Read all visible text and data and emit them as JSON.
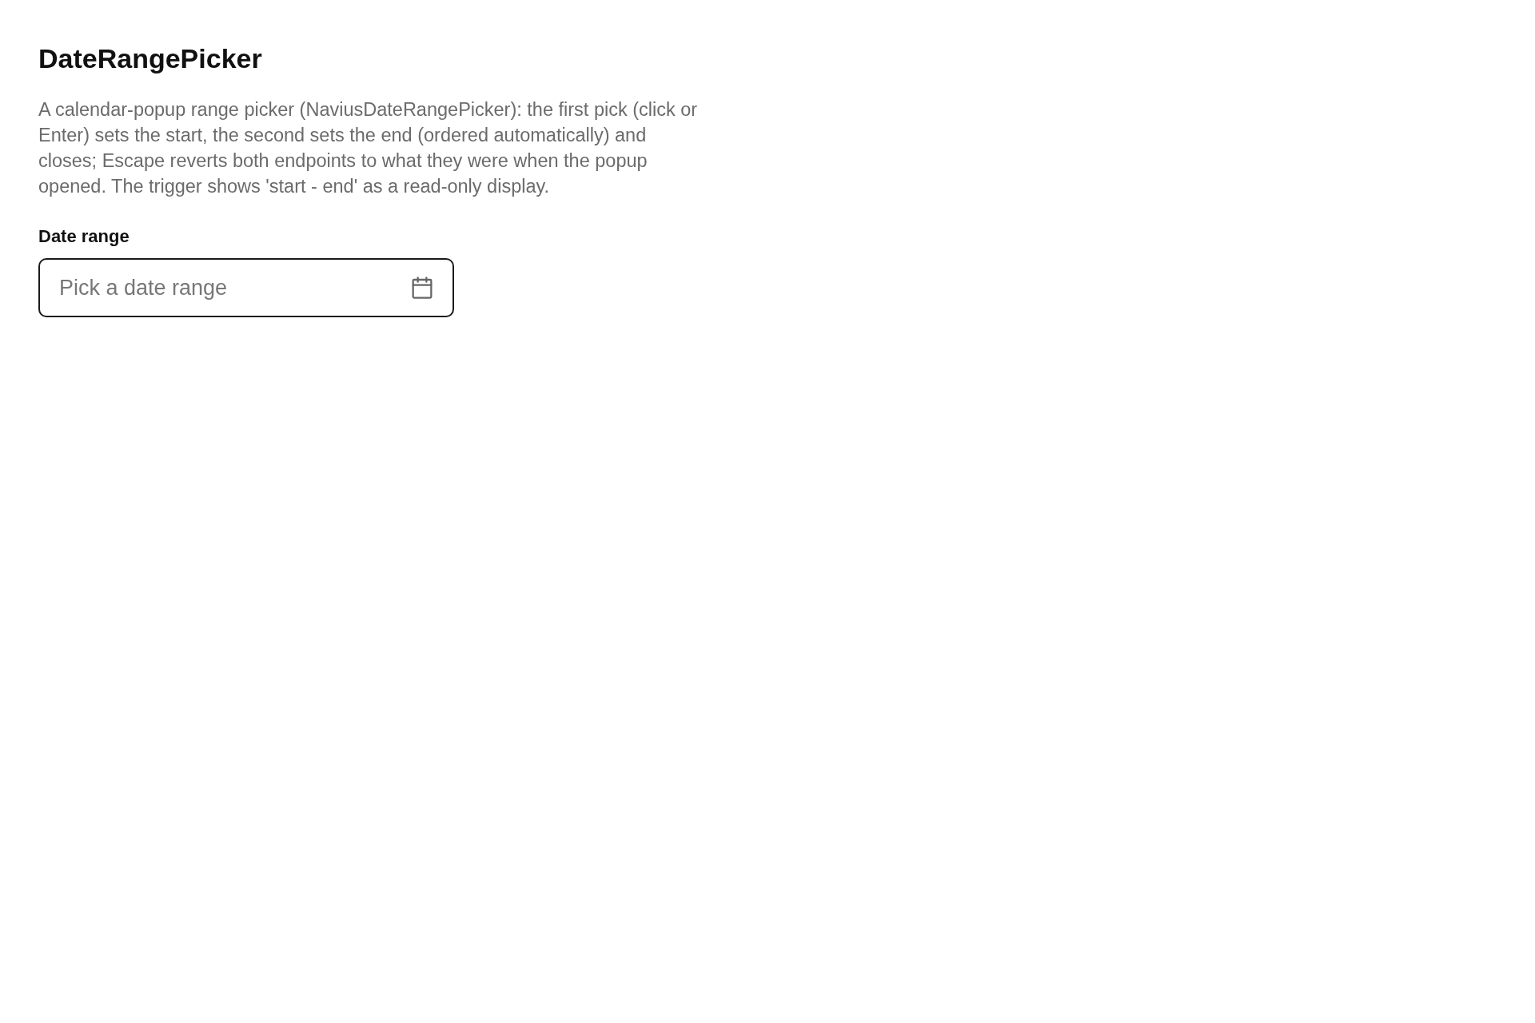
{
  "title": "DateRangePicker",
  "description": "A calendar-popup range picker (NaviusDateRangePicker): the first pick (click or Enter) sets the start, the second sets the end (ordered automatically) and closes; Escape reverts both endpoints to what they were when the popup opened. The trigger shows 'start - end' as a read-only display.",
  "date_range_field": {
    "label": "Date range",
    "placeholder": "Pick a date range"
  }
}
